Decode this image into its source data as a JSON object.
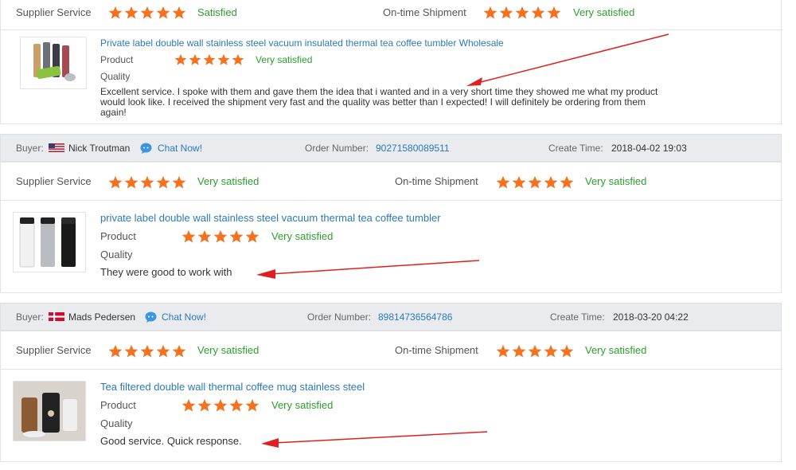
{
  "labels": {
    "buyer": "Buyer:",
    "chat_now": "Chat Now!",
    "order_number": "Order Number:",
    "create_time": "Create Time:",
    "supplier_service": "Supplier Service",
    "ontime_shipment": "On-time Shipment",
    "product": "Product",
    "quality": "Quality"
  },
  "colors": {
    "star": "#f5711e",
    "satisfied": "#2ba02b",
    "link": "#2a7ab8",
    "arrow": "#e02020"
  },
  "reviews": [
    {
      "supplier_rating": 5,
      "supplier_text": "Satisfied",
      "shipment_rating": 5,
      "shipment_text": "Very satisfied",
      "product_title": "Private label double wall stainless steel vacuum insulated thermal tea coffee tumbler Wholesale",
      "product_rating": 5,
      "product_text": "Very satisfied",
      "comment": "Excellent service. I spoke with them and gave them the idea that i wanted and in a very short time they showed me what my product would look like. I received the shipment very fast and the quality was better than I expected! I will definitely be ordering from them again!"
    },
    {
      "buyer_name": "Nick Troutman",
      "country_flag": "us-flag-icon",
      "order_number": "90271580089511",
      "create_time": "2018-04-02 19:03",
      "supplier_rating": 5,
      "supplier_text": "Very satisfied",
      "shipment_rating": 5,
      "shipment_text": "Very satisfied",
      "product_title": "private label double wall stainless steel vacuum thermal tea coffee tumbler",
      "product_rating": 5,
      "product_text": "Very satisfied",
      "comment": "They were good to work with"
    },
    {
      "buyer_name": "Mads Pedersen",
      "country_flag": "dk-flag-icon",
      "order_number": "89814736564786",
      "create_time": "2018-03-20 04:22",
      "supplier_rating": 5,
      "supplier_text": "Very satisfied",
      "shipment_rating": 5,
      "shipment_text": "Very satisfied",
      "product_title": "Tea filtered double wall thermal coffee mug stainless steel",
      "product_rating": 5,
      "product_text": "Very satisfied",
      "comment": "Good service. Quick response."
    }
  ]
}
